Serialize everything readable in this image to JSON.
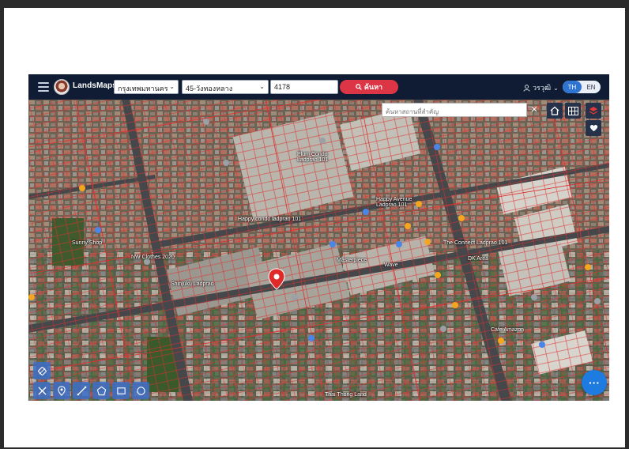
{
  "app": {
    "brand": "LandsMaps",
    "province_value": "กรุงเทพมหานคร",
    "district_value": "45-วังทองหลาง",
    "parcel_value": "4178",
    "search_label": "ค้นหา",
    "user_name": "วรวุฒิ",
    "lang_th": "TH",
    "lang_en": "EN",
    "overlay_search_placeholder": "ค้นหาสถานที่สำคัญ",
    "fab_label": "···",
    "accent_color": "#2f74d0",
    "search_btn_color": "#dc3545",
    "topbar_color": "#0f1c33"
  },
  "map": {
    "labels": [
      {
        "text": "Plum Condo",
        "sub": "Ladprao 101"
      },
      {
        "text": "Happy condo ladprao 101",
        "sub": ""
      },
      {
        "text": "Happy Avenue",
        "sub": "Ladprao 101"
      },
      {
        "text": "Sunny Shop",
        "sub": ""
      },
      {
        "text": "NW Clothes 2020",
        "sub": ""
      },
      {
        "text": "Shinjuku Ladprao",
        "sub": ""
      },
      {
        "text": "The Connect",
        "sub": "Ladprao 101"
      },
      {
        "text": "DK Area",
        "sub": ""
      },
      {
        "text": "Cafe Amazon",
        "sub": ""
      },
      {
        "text": "Thai Thong Land",
        "sub": ""
      },
      {
        "text": "Masterpiece",
        "sub": ""
      },
      {
        "text": "Wave",
        "sub": ""
      }
    ]
  },
  "tools": [
    "layers-icon",
    "measure-icon",
    "pin-icon",
    "line-icon",
    "polygon-icon",
    "rectangle-icon",
    "circle-icon"
  ]
}
